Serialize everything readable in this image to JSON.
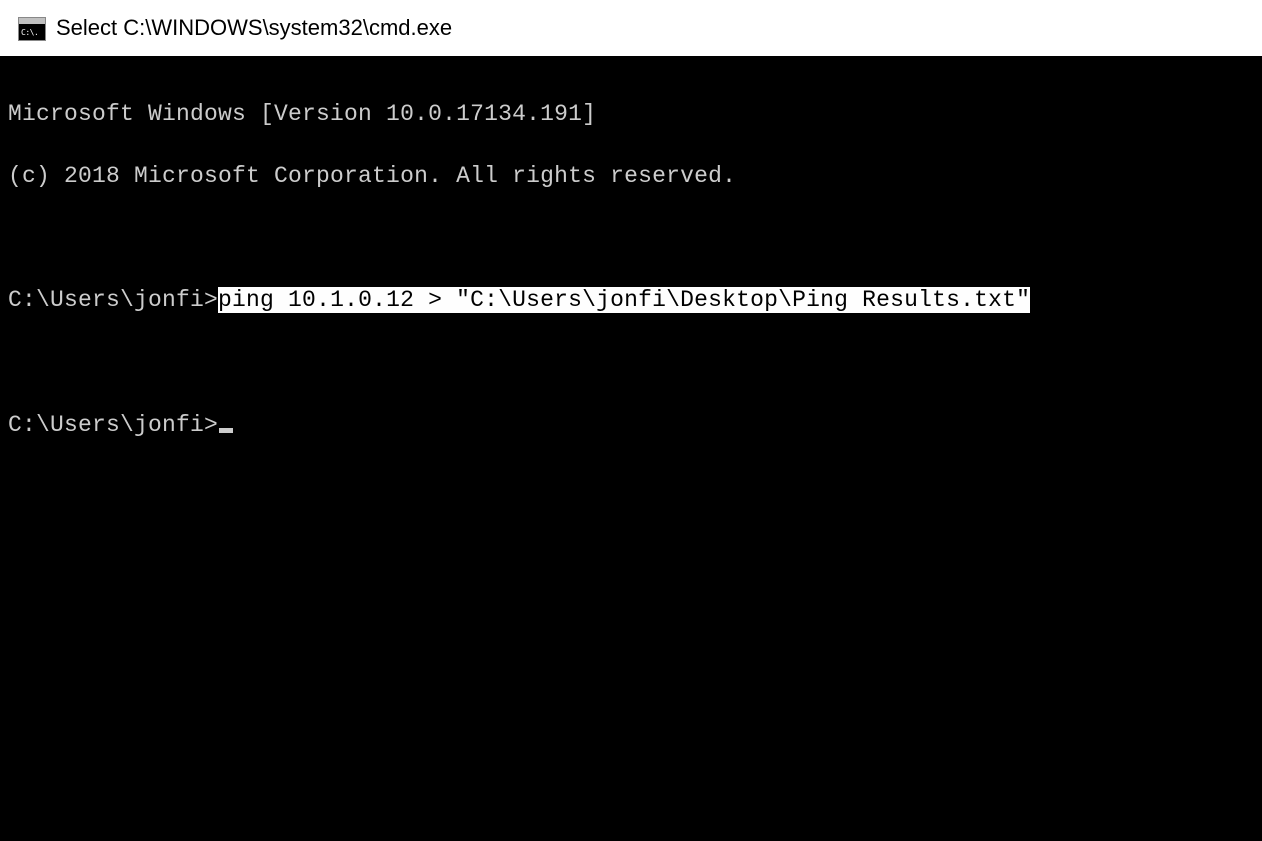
{
  "titlebar": {
    "icon_label": "C:\\.",
    "title": "Select C:\\WINDOWS\\system32\\cmd.exe"
  },
  "terminal": {
    "header_line1": "Microsoft Windows [Version 10.0.17134.191]",
    "header_line2": "(c) 2018 Microsoft Corporation. All rights reserved.",
    "prompt1": "C:\\Users\\jonfi>",
    "command1_selected": "ping 10.1.0.12 > \"C:\\Users\\jonfi\\Desktop\\Ping Results.txt\"",
    "prompt2": "C:\\Users\\jonfi>"
  }
}
